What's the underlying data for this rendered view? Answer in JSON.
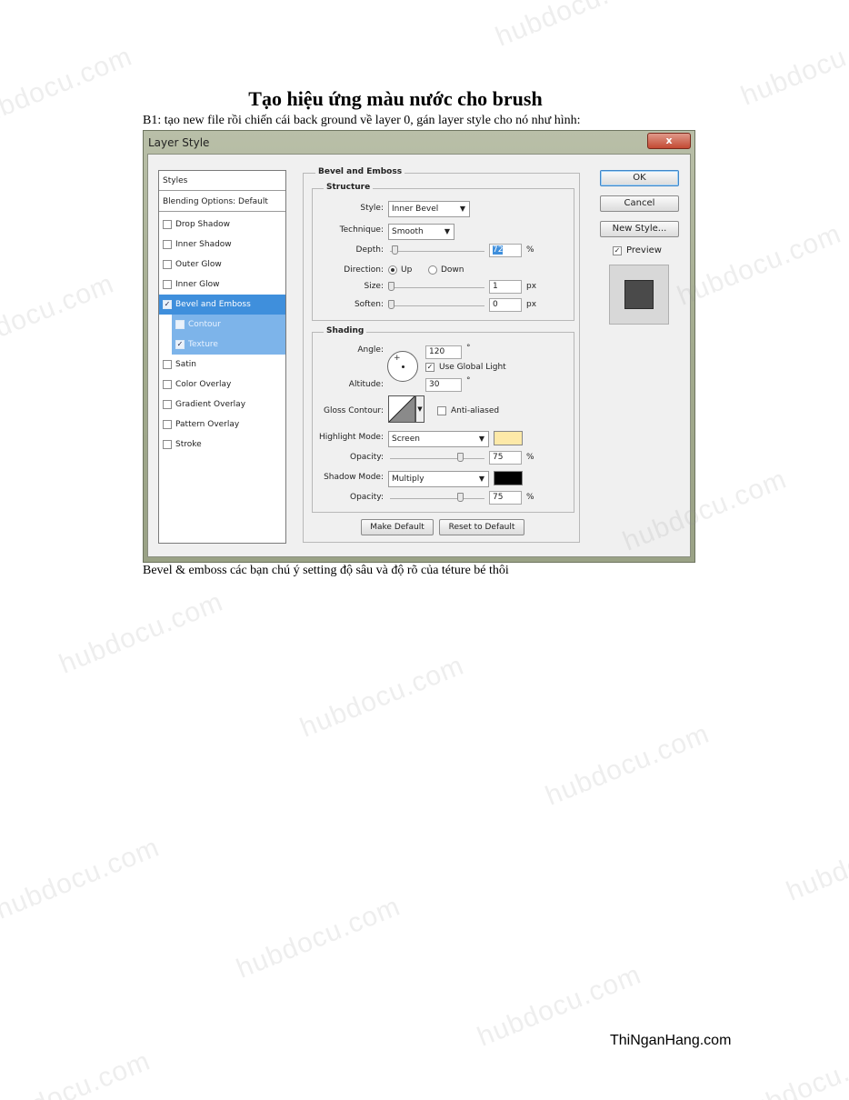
{
  "document": {
    "title": "Tạo hiệu ứng màu nước cho brush",
    "intro": "B1: tạo new file rồi chiến cái back ground về layer 0, gán layer style cho nó như hình:",
    "caption": "Bevel & emboss các bạn chú ý setting độ sâu và độ rõ của téture bé thôi",
    "footer": "ThiNganHang.com",
    "watermark": "hubdocu.com"
  },
  "dialog": {
    "title": "Layer Style",
    "close_label": "x",
    "sidebar": {
      "styles_label": "Styles",
      "blending_label": "Blending Options: Default",
      "items": [
        {
          "label": "Drop Shadow",
          "checked": false
        },
        {
          "label": "Inner Shadow",
          "checked": false
        },
        {
          "label": "Outer Glow",
          "checked": false
        },
        {
          "label": "Inner Glow",
          "checked": false
        },
        {
          "label": "Bevel and Emboss",
          "checked": true
        },
        {
          "label": "Contour",
          "checked": false
        },
        {
          "label": "Texture",
          "checked": true
        },
        {
          "label": "Satin",
          "checked": false
        },
        {
          "label": "Color Overlay",
          "checked": false
        },
        {
          "label": "Gradient Overlay",
          "checked": false
        },
        {
          "label": "Pattern Overlay",
          "checked": false
        },
        {
          "label": "Stroke",
          "checked": false
        }
      ]
    },
    "bevel": {
      "group_title": "Bevel and Emboss",
      "structure_title": "Structure",
      "style_label": "Style:",
      "style_value": "Inner Bevel",
      "technique_label": "Technique:",
      "technique_value": "Smooth",
      "depth_label": "Depth:",
      "depth_value": "72",
      "depth_unit": "%",
      "direction_label": "Direction:",
      "direction_up": "Up",
      "direction_down": "Down",
      "size_label": "Size:",
      "size_value": "1",
      "size_unit": "px",
      "soften_label": "Soften:",
      "soften_value": "0",
      "soften_unit": "px"
    },
    "shading": {
      "title": "Shading",
      "angle_label": "Angle:",
      "angle_value": "120",
      "angle_unit": "°",
      "global_light_label": "Use Global Light",
      "altitude_label": "Altitude:",
      "altitude_value": "30",
      "altitude_unit": "°",
      "gloss_contour_label": "Gloss Contour:",
      "anti_aliased_label": "Anti-aliased",
      "highlight_mode_label": "Highlight Mode:",
      "highlight_mode_value": "Screen",
      "highlight_color": "#fde9a8",
      "highlight_opacity_label": "Opacity:",
      "highlight_opacity_value": "75",
      "highlight_opacity_unit": "%",
      "shadow_mode_label": "Shadow Mode:",
      "shadow_mode_value": "Multiply",
      "shadow_color": "#000000",
      "shadow_opacity_label": "Opacity:",
      "shadow_opacity_value": "75",
      "shadow_opacity_unit": "%"
    },
    "buttons": {
      "make_default": "Make Default",
      "reset_default": "Reset to Default",
      "ok": "OK",
      "cancel": "Cancel",
      "new_style": "New Style...",
      "preview_label": "Preview"
    }
  }
}
